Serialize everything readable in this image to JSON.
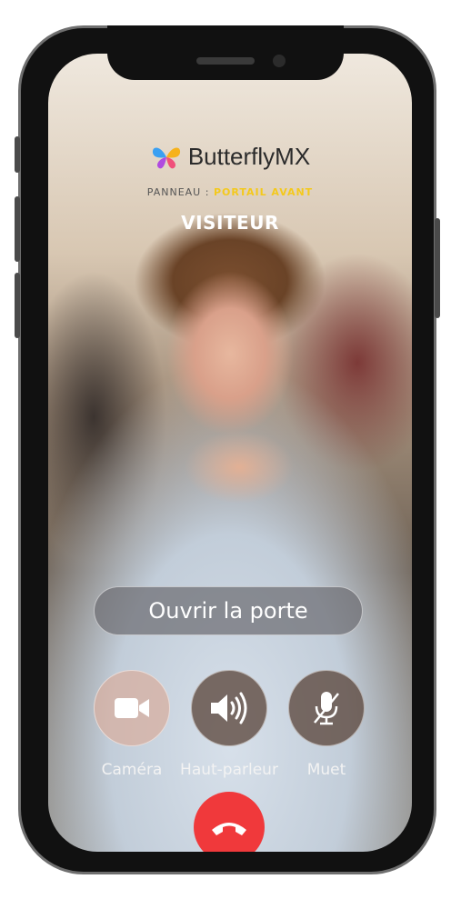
{
  "app": {
    "brand": "ButterflyMX"
  },
  "call": {
    "panel_prefix": "PANNEAU :",
    "panel_name": "PORTAIL AVANT",
    "caller_label": "VISITEUR"
  },
  "actions": {
    "open_door": "Ouvrir la porte",
    "camera": "Caméra",
    "speaker": "Haut-parleur",
    "mute": "Muet"
  },
  "colors": {
    "hangup": "#f0393b",
    "panel_highlight": "#f4c91c",
    "icons": [
      "camera-icon",
      "speaker-icon",
      "mic-off-icon",
      "hangup-icon",
      "butterfly-logo-icon"
    ]
  }
}
